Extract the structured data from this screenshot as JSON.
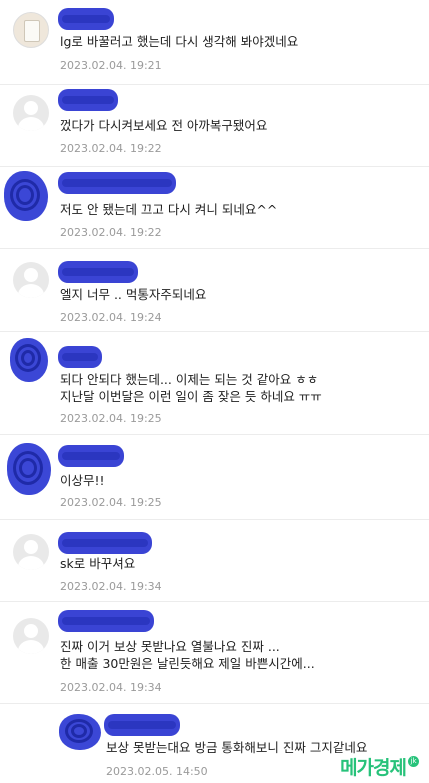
{
  "comments": [
    {
      "text": "lg로 바꿀러고 했는데 다시 생각해 봐야겠네요",
      "date": "2023.02.04. 19:21"
    },
    {
      "text": "껐다가 다시켜보세요 전 아까복구됐어요",
      "date": "2023.02.04. 19:22"
    },
    {
      "text": "저도 안 됐는데 끄고 다시 켜니 되네요^^",
      "date": "2023.02.04. 19:22"
    },
    {
      "text": "엘지 너무 .. 먹통자주되네요",
      "date": "2023.02.04. 19:24"
    },
    {
      "text": "되다 안되다 했는데... 이제는 되는 것 같아요 ㅎㅎ",
      "text2": "지난달 이번달은 이런 일이 좀 잦은 듯 하네요 ㅠㅠ",
      "date": "2023.02.04. 19:25"
    },
    {
      "text": "이상무!!",
      "date": "2023.02.04. 19:25"
    },
    {
      "text": "sk로 바꾸셔요",
      "date": "2023.02.04. 19:34"
    },
    {
      "text": "진짜 이거 보상 못받나요 열불나요 진짜 ...",
      "text2": "한 매출 30만원은 날린듯해요 제일 바쁜시간에...",
      "date": "2023.02.04. 19:34"
    },
    {
      "text": "보상 못받는대요 방금 통화해보니 진짜 그지같네요",
      "date": "2023.02.05. 14:50"
    }
  ],
  "watermark": {
    "text": "메가경제",
    "badge": "jk"
  },
  "icons": {
    "avatar_default": "default-profile-icon",
    "avatar_photo": "profile-photo",
    "avatar_blob": "redacted-profile-photo"
  },
  "colors": {
    "redaction": "#3a44d4",
    "watermark": "#27c27a",
    "date": "#9a9a9a"
  }
}
